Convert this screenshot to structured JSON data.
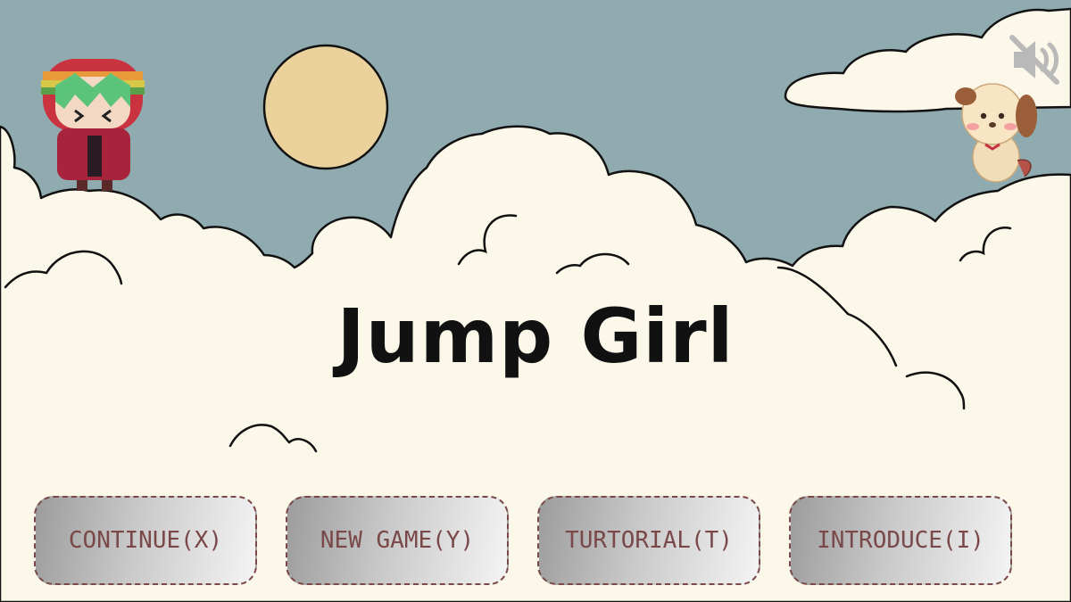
{
  "game": {
    "title": "Jump Girl"
  },
  "menu": {
    "continue_label": "CONTINUE(X)",
    "new_game_label": "NEW GAME(Y)",
    "tutorial_label": "TURTORIAL(T)",
    "introduce_label": "INTRODUCE(I)"
  },
  "sound": {
    "state": "muted",
    "icon": "speaker-muted-icon"
  },
  "colors": {
    "sky": "#8fabb0",
    "cloud": "#fbf8ea",
    "sun": "#ebd29c",
    "button_text": "#7a4848",
    "title_text": "#111111"
  }
}
